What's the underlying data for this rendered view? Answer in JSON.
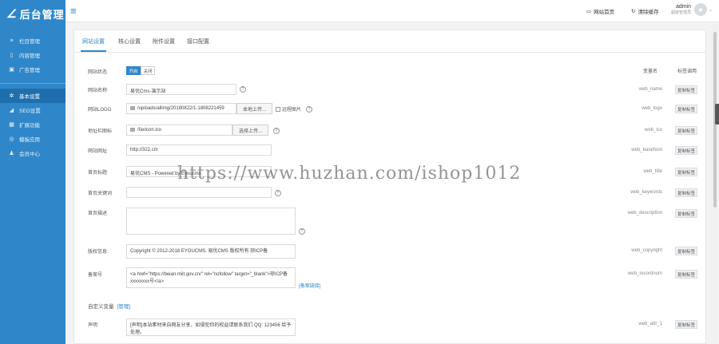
{
  "brand": {
    "logo_mark": "∠",
    "title": "后台管理"
  },
  "sidebar": {
    "items": [
      {
        "icon": "≡",
        "label": "栏目管理",
        "active": false
      },
      {
        "icon": "▯",
        "label": "内容管理",
        "active": false
      },
      {
        "icon": "▣",
        "label": "广告管理",
        "active": false
      },
      {
        "icon": "✲",
        "label": "基本设置",
        "active": true
      },
      {
        "icon": "◢",
        "label": "SEO设置",
        "active": false
      },
      {
        "icon": "▦",
        "label": "扩展功能",
        "active": false
      },
      {
        "icon": "◎",
        "label": "模板应用",
        "active": false
      },
      {
        "icon": "♟",
        "label": "会员中心",
        "active": false
      }
    ]
  },
  "topbar": {
    "menu_icon": "≡",
    "site_home": "网站首页",
    "clear_cache": "清除缓存",
    "user_name": "admin",
    "user_role": "超级管理员"
  },
  "tabs": [
    "网站设置",
    "核心设置",
    "附件设置",
    "接口配置"
  ],
  "columns": {
    "var_name": "变量名",
    "call_code": "标签调用"
  },
  "form": {
    "status": {
      "label": "网站状态",
      "on": "开启",
      "off": "关闭",
      "var": "web_name",
      "call": "复制标签"
    },
    "name": {
      "label": "网站名称",
      "value": "易优Cms-演示站",
      "var": "web_name",
      "call": "复制标签"
    },
    "logo": {
      "label": "网站LOGO",
      "value": "/uploads/allimg/20180822/1-1808221459",
      "upload": "本地上传...",
      "remote_label": "远程图片",
      "var": "web_logo",
      "call": "复制标签"
    },
    "ico": {
      "label": "地址栏图标",
      "value": "/favicon.ico",
      "upload": "选择上传...",
      "var": "web_ico",
      "call": "复制标签"
    },
    "url": {
      "label": "网站网址",
      "value": "http://322.cm",
      "var": "web_basehost",
      "call": "复制标签"
    },
    "title": {
      "label": "首页标题",
      "value": "易优CMS - Powered by Eyoucms",
      "var": "web_title",
      "call": "复制标签"
    },
    "keywords": {
      "label": "首页关键词",
      "value": "",
      "var": "web_keywords",
      "call": "复制标签"
    },
    "description": {
      "label": "首页描述",
      "value": "",
      "var": "web_description",
      "call": "复制标签"
    },
    "copyright": {
      "label": "版权信息",
      "value": "Copyright © 2012-2018 EYOUCMS. 易优CMS 版权所有 琼ICP备",
      "var": "web_copyright",
      "call": "复制标签"
    },
    "recordnum": {
      "label": "备案号",
      "value": "<a href=\"https://beian.miit.gov.cn/\" rel=\"nofollow\" target=\"_blank\">琼ICP备xxxxxxxx号</a>",
      "link_text": "[备案链接]",
      "var": "web_recordnum",
      "call": "复制标签"
    },
    "custom": {
      "label": "自定义变量",
      "link": "[管理]"
    },
    "statement": {
      "label": "声明",
      "value": "[声明]本站素材来自网友分享，如侵犯你的权益请联系我们 QQ: 123456 给予处理。",
      "var": "web_attr_1",
      "call": "复制标签"
    }
  },
  "watermark": "https://www.huzhan.com/ishop1012"
}
